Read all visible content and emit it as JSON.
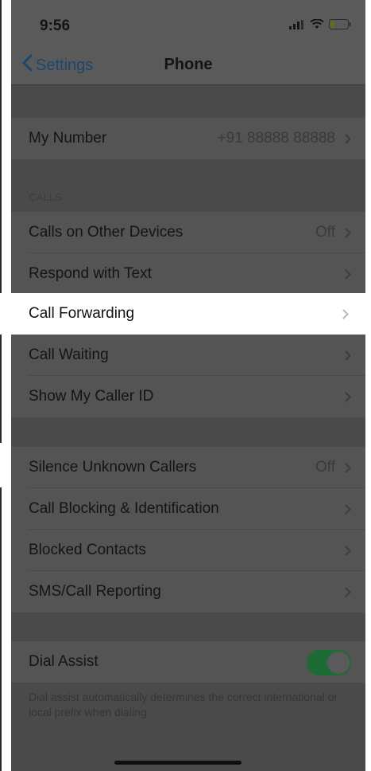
{
  "status_bar": {
    "time": "9:56",
    "icons": [
      "signal-icon",
      "wifi-icon",
      "battery-icon"
    ]
  },
  "nav": {
    "back_label": "Settings",
    "title": "Phone"
  },
  "rows": {
    "my_number": {
      "label": "My Number",
      "value": "+91 88888 88888"
    },
    "calls_header": "CALLS",
    "calls_on_other_devices": {
      "label": "Calls on Other Devices",
      "value": "Off"
    },
    "respond_with_text": {
      "label": "Respond with Text"
    },
    "call_forwarding": {
      "label": "Call Forwarding"
    },
    "call_waiting": {
      "label": "Call Waiting"
    },
    "show_my_caller_id": {
      "label": "Show My Caller ID"
    },
    "silence_unknown_callers": {
      "label": "Silence Unknown Callers",
      "value": "Off"
    },
    "call_blocking": {
      "label": "Call Blocking & Identification"
    },
    "blocked_contacts": {
      "label": "Blocked Contacts"
    },
    "sms_call_reporting": {
      "label": "SMS/Call Reporting"
    },
    "dial_assist": {
      "label": "Dial Assist",
      "enabled": true
    }
  },
  "footer_note": "Dial assist automatically determines the correct international or local prefix when dialing.",
  "colors": {
    "dim_background": "#4a4a4a",
    "cell_background": "#545454",
    "highlight_background": "#ffffff",
    "link_blue": "#1a4770",
    "toggle_green": "#1d6b35"
  }
}
